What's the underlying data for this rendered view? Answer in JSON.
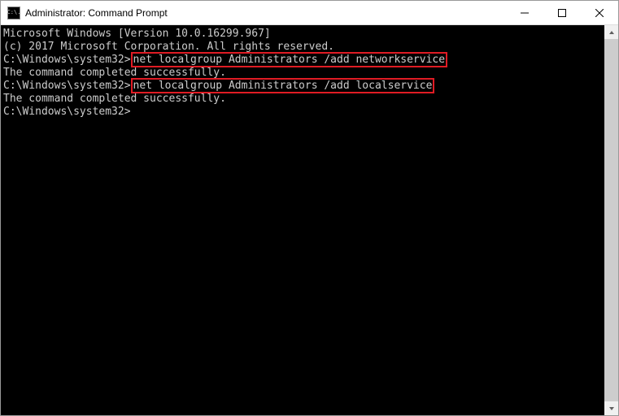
{
  "window": {
    "title": "Administrator: Command Prompt",
    "icon_text": "C:\\."
  },
  "terminal": {
    "line1": "Microsoft Windows [Version 10.0.16299.967]",
    "line2": "(c) 2017 Microsoft Corporation. All rights reserved.",
    "blank": "",
    "prompt1_prefix": "C:\\Windows\\system32>",
    "cmd1": "net localgroup Administrators /add networkservice",
    "result1": "The command completed successfully.",
    "prompt2_prefix": "C:\\Windows\\system32>",
    "cmd2": "net localgroup Administrators /add localservice",
    "result2": "The command completed successfully.",
    "prompt3": "C:\\Windows\\system32>"
  }
}
